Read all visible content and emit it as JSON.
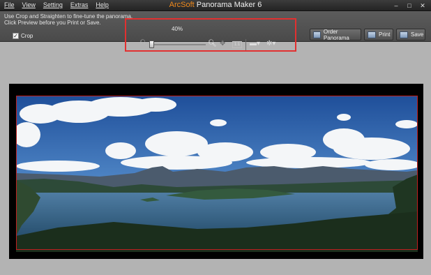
{
  "menu": [
    "File",
    "View",
    "Setting",
    "Extras",
    "Help"
  ],
  "title": {
    "brand": "ArcSoft",
    "product": "Panorama Maker 6"
  },
  "window_controls": [
    "–",
    "□",
    "✕"
  ],
  "instructions": {
    "line1": "Use Crop and Straighten to fine-tune the panorama.",
    "line2": "Click Preview before you Print or Save."
  },
  "crop": {
    "label": "Crop",
    "checked": true,
    "checkmark": "✓"
  },
  "zoom": {
    "value_label": "40%",
    "level_percent": 40
  },
  "fit_label": "1:1",
  "buttons": {
    "order": "Order Panorama",
    "print": "Print",
    "save": "Save"
  },
  "colors": {
    "brand": "#f08a1c",
    "highlight": "#e23030",
    "crop_border": "#c02020"
  }
}
